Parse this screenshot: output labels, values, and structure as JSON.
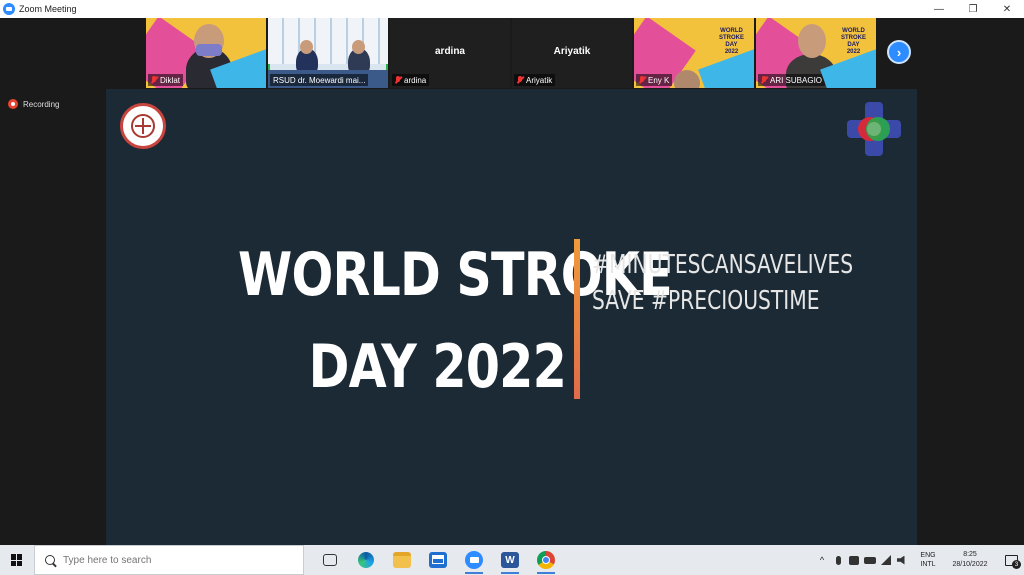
{
  "window": {
    "title": "Zoom Meeting",
    "controls": {
      "minimize": "—",
      "restore": "❐",
      "close": "✕"
    }
  },
  "participants": [
    {
      "name": "Diklat",
      "video": "person-masked",
      "muted": true
    },
    {
      "name": "RSUD dr. Moewardi mai...",
      "video": "hall",
      "muted": false,
      "active_speaker": true
    },
    {
      "name": "ardina",
      "video": "off",
      "muted": true
    },
    {
      "name": "Ariyatik",
      "video": "off",
      "muted": true
    },
    {
      "name": "Eny K",
      "video": "poster",
      "muted": true
    },
    {
      "name": "ARI SUBAGIO",
      "video": "person-poster",
      "muted": true
    }
  ],
  "poster_text": "WORLD\nSTROKE\nDAY\n2022",
  "next_page_icon": "›",
  "recording": {
    "label": "Recording"
  },
  "slide": {
    "headline_line1": "WORLD STROKE",
    "headline_line2": "DAY 2022",
    "tagline_line1": "#MINUTESCANSAVELIVES",
    "tagline_line2": "SAVE #PRECIOUSTIME",
    "colors": {
      "background": "#1b2a35",
      "divider": "#f09a3a"
    }
  },
  "taskbar": {
    "search_placeholder": "Type here to search",
    "word_letter": "W",
    "language_line1": "ENG",
    "language_line2": "INTL",
    "time": "8:25",
    "date": "28/10/2022",
    "notification_count": "3",
    "tray_chevron": "^"
  }
}
